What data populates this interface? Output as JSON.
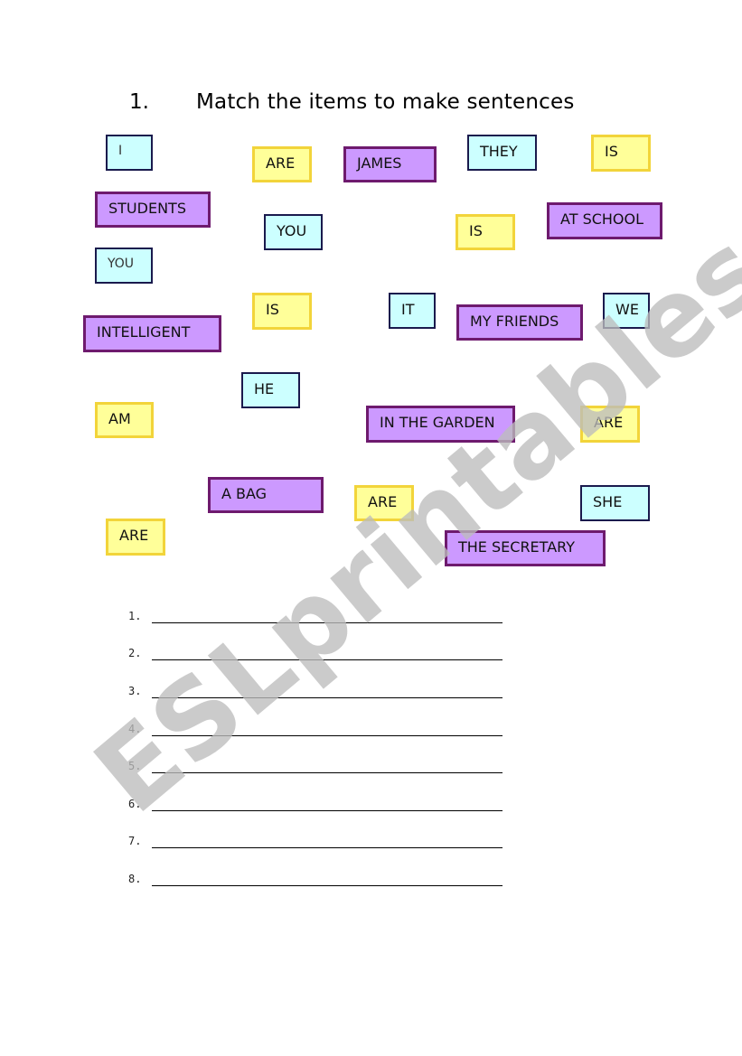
{
  "exercise": {
    "number": "1.",
    "instruction": "Match the items to make sentences"
  },
  "word_boxes": [
    {
      "text": "I",
      "color": "blue"
    },
    {
      "text": "ARE",
      "color": "yellow"
    },
    {
      "text": "JAMES",
      "color": "purple"
    },
    {
      "text": "THEY",
      "color": "blue"
    },
    {
      "text": "IS",
      "color": "yellow"
    },
    {
      "text": "STUDENTS",
      "color": "purple"
    },
    {
      "text": "YOU",
      "color": "blue"
    },
    {
      "text": "IS",
      "color": "yellow"
    },
    {
      "text": "AT SCHOOL",
      "color": "purple"
    },
    {
      "text": "YOU",
      "color": "blue"
    },
    {
      "text": "IS",
      "color": "yellow"
    },
    {
      "text": "IT",
      "color": "blue"
    },
    {
      "text": "MY FRIENDS",
      "color": "purple"
    },
    {
      "text": "WE",
      "color": "blue"
    },
    {
      "text": "INTELLIGENT",
      "color": "purple"
    },
    {
      "text": "HE",
      "color": "blue"
    },
    {
      "text": "AM",
      "color": "yellow"
    },
    {
      "text": "IN THE GARDEN",
      "color": "purple"
    },
    {
      "text": "ARE",
      "color": "yellow"
    },
    {
      "text": "A BAG",
      "color": "purple"
    },
    {
      "text": "ARE",
      "color": "yellow"
    },
    {
      "text": "SHE",
      "color": "blue"
    },
    {
      "text": "ARE",
      "color": "yellow"
    },
    {
      "text": "THE SECRETARY",
      "color": "purple"
    }
  ],
  "answer_lines": [
    {
      "label": "1.",
      "value": ""
    },
    {
      "label": "2.",
      "value": ""
    },
    {
      "label": "3.",
      "value": ""
    },
    {
      "label": "4.",
      "value": ""
    },
    {
      "label": "5.",
      "value": ""
    },
    {
      "label": "6.",
      "value": ""
    },
    {
      "label": "7.",
      "value": ""
    },
    {
      "label": "8.",
      "value": ""
    }
  ],
  "watermark": "ESLprintables.com",
  "colors": {
    "blue_fill": "#ccffff",
    "blue_border": "#1a1a4d",
    "yellow_fill": "#ffff99",
    "yellow_border": "#f2d43a",
    "purple_fill": "#cc99ff",
    "purple_border": "#6e1a6e",
    "watermark": "#c8c8c8"
  }
}
